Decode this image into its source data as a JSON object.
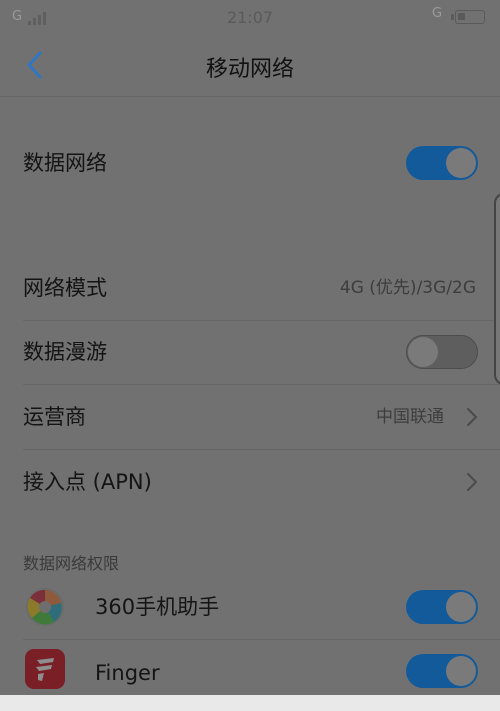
{
  "status_bar": {
    "left_network": "G",
    "time": "21:07",
    "right_network": "G"
  },
  "nav": {
    "title": "移动网络",
    "back_icon": "chevron-left-icon"
  },
  "settings": {
    "data_network": {
      "label": "数据网络",
      "toggle_on": true
    },
    "network_mode": {
      "label": "网络模式",
      "value": "4G (优先)/3G/2G"
    },
    "data_roaming": {
      "label": "数据漫游",
      "toggle_on": false
    },
    "carrier": {
      "label": "运营商",
      "value": "中国联通"
    },
    "apn": {
      "label": "接入点 (APN)"
    }
  },
  "permissions": {
    "header": "数据网络权限",
    "apps": [
      {
        "name": "360手机助手",
        "icon": "360-assistant-icon",
        "toggle_on": true
      },
      {
        "name": "Finger",
        "icon": "finger-app-icon",
        "toggle_on": true
      }
    ]
  },
  "colors": {
    "toggle_on": "#135a9a",
    "accent_back": "#2f76c4"
  }
}
